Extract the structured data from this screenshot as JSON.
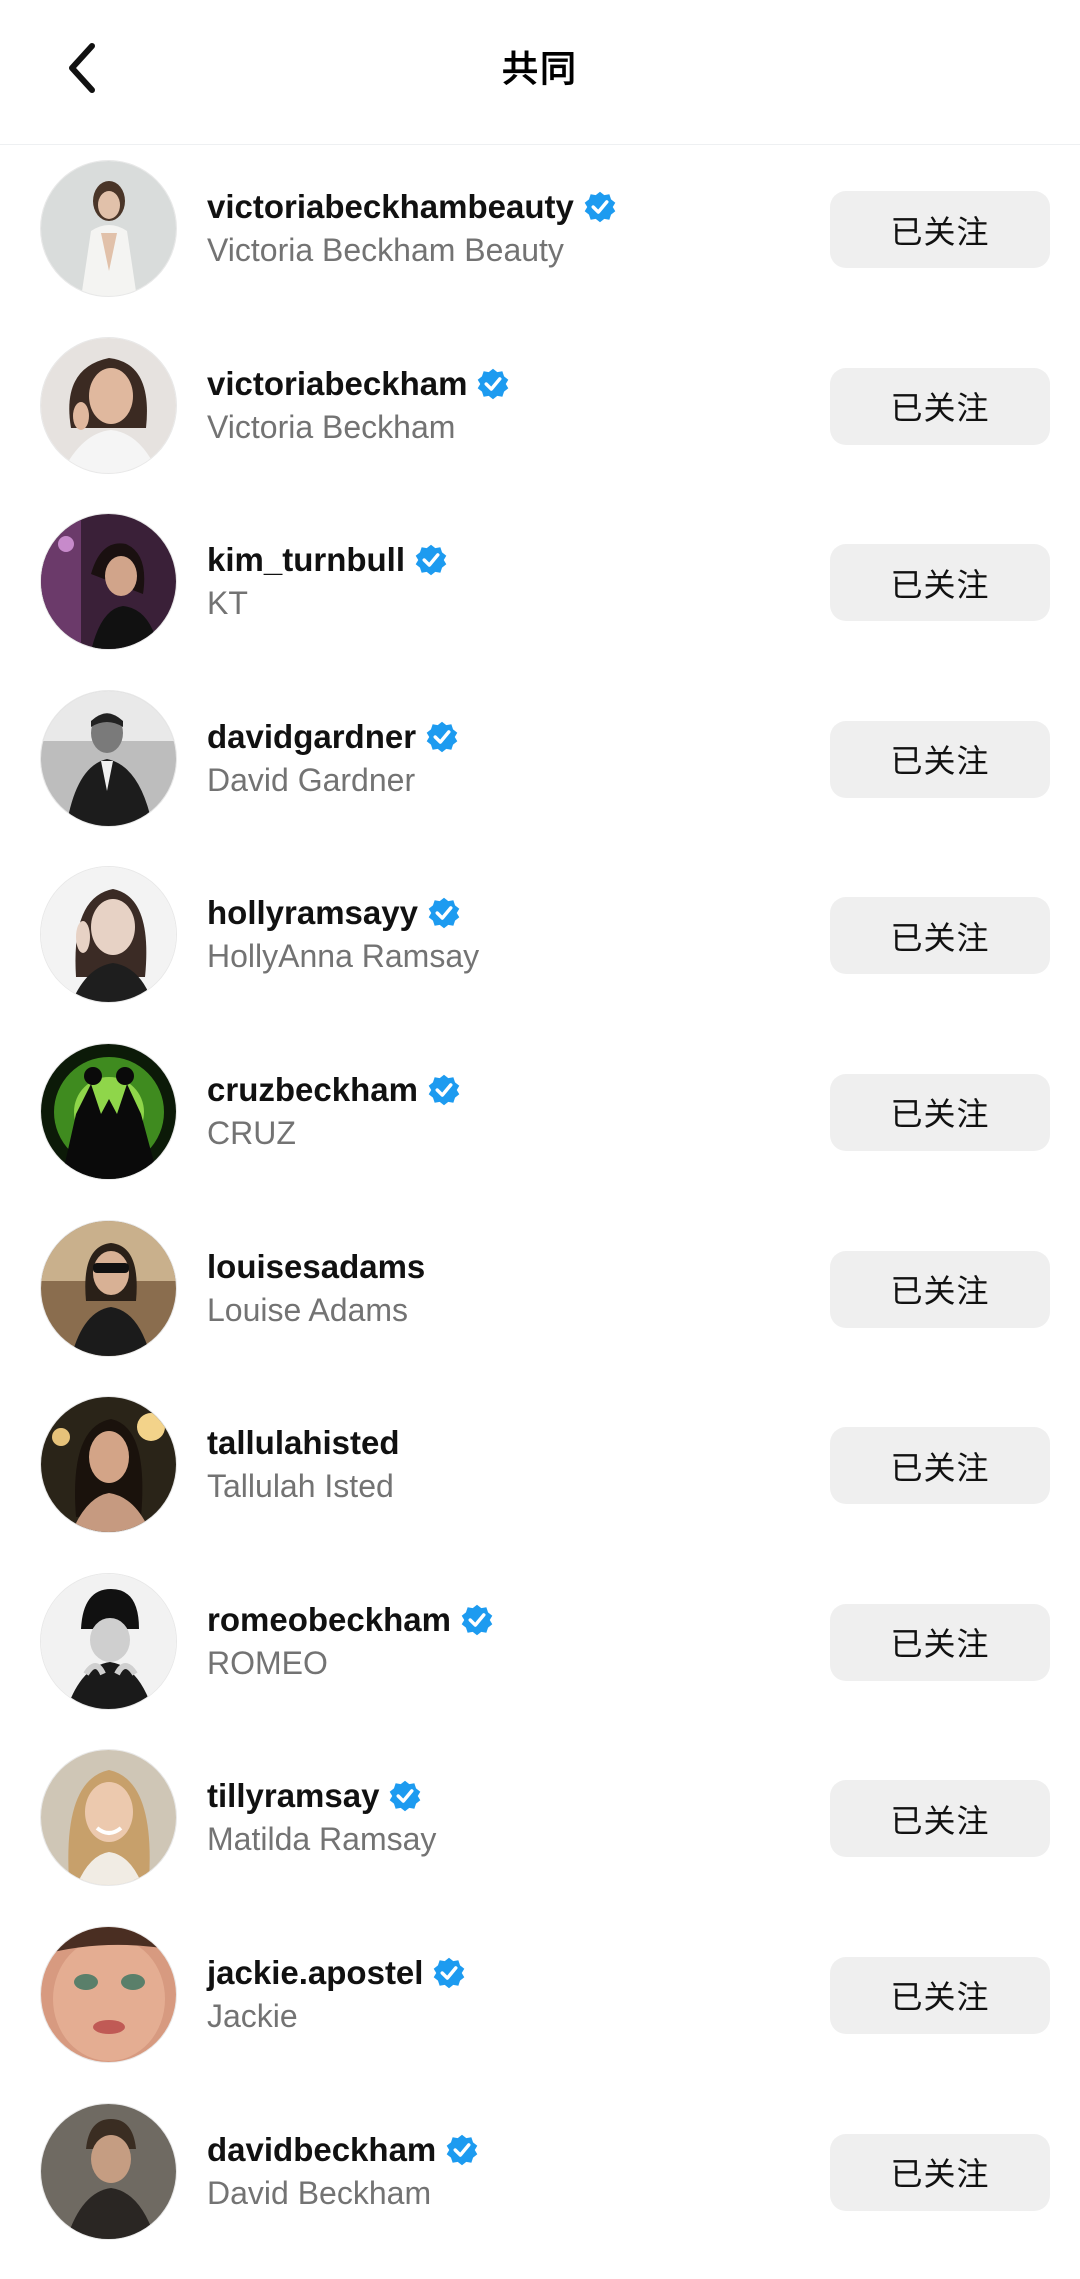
{
  "header": {
    "title": "共同",
    "back_icon": "chevron-left-icon"
  },
  "colors": {
    "verified": "#1d9bf0",
    "button_bg": "#efefef",
    "secondary_text": "#737373"
  },
  "rows": [
    {
      "handle": "victoriabeckhambeauty",
      "display_name": "Victoria Beckham Beauty",
      "verified": true,
      "button": "已关注"
    },
    {
      "handle": "victoriabeckham",
      "display_name": "Victoria Beckham",
      "verified": true,
      "button": "已关注"
    },
    {
      "handle": "kim_turnbull",
      "display_name": "KT",
      "verified": true,
      "button": "已关注"
    },
    {
      "handle": "davidgardner",
      "display_name": "David Gardner",
      "verified": true,
      "button": "已关注"
    },
    {
      "handle": "hollyramsayy",
      "display_name": "HollyAnna Ramsay",
      "verified": true,
      "button": "已关注"
    },
    {
      "handle": "cruzbeckham",
      "display_name": "CRUZ",
      "verified": true,
      "button": "已关注"
    },
    {
      "handle": "louisesadams",
      "display_name": "Louise Adams",
      "verified": false,
      "button": "已关注"
    },
    {
      "handle": "tallulahisted",
      "display_name": "Tallulah Isted",
      "verified": false,
      "button": "已关注"
    },
    {
      "handle": "romeobeckham",
      "display_name": "ROMEO",
      "verified": true,
      "button": "已关注"
    },
    {
      "handle": "tillyramsay",
      "display_name": "Matilda Ramsay",
      "verified": true,
      "button": "已关注"
    },
    {
      "handle": "jackie.apostel",
      "display_name": "Jackie",
      "verified": true,
      "button": "已关注"
    },
    {
      "handle": "davidbeckham",
      "display_name": "David Beckham",
      "verified": true,
      "button": "已关注"
    }
  ]
}
